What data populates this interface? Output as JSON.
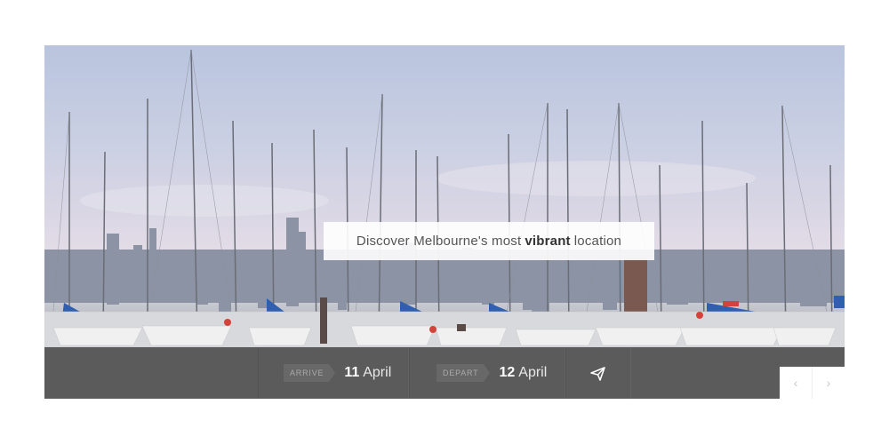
{
  "hero": {
    "image": "marina-sailboats-melbourne-skyline",
    "tagline": {
      "before": "Discover Melbourne's most",
      "emphasis": "vibrant",
      "after": "location"
    }
  },
  "booking": {
    "arrive": {
      "label": "ARRIVE",
      "day": "11",
      "month": "April"
    },
    "depart": {
      "label": "DEPART",
      "day": "12",
      "month": "April"
    },
    "submit_icon": "paper-plane-icon"
  },
  "slider_nav": {
    "prev_icon": "chevron-left-icon",
    "next_icon": "chevron-right-icon",
    "prev_glyph": "‹",
    "next_glyph": "›"
  },
  "colors": {
    "bar_background": "#5b5b5b",
    "tag_background": "#686868",
    "sky": "#c9cfe3"
  }
}
